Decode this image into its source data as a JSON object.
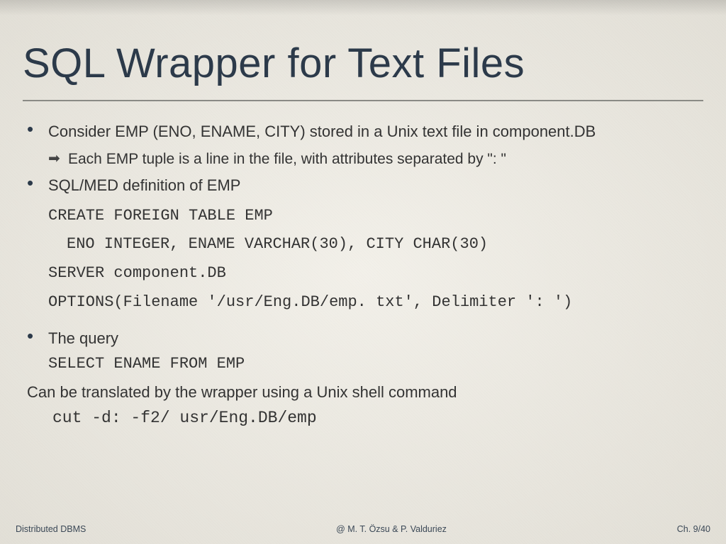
{
  "title": "SQL Wrapper for Text Files",
  "bullets": {
    "b1": "Consider EMP (ENO, ENAME, CITY) stored in a Unix text file in component.DB",
    "b1_sub": "Each EMP tuple is a line in the file, with attributes separated by \": \"",
    "b2": "SQL/MED definition of EMP",
    "b3": "The query"
  },
  "code": {
    "l1": "CREATE FOREIGN TABLE EMP",
    "l2": "ENO INTEGER, ENAME VARCHAR(30), CITY CHAR(30)",
    "l3": "SERVER component.DB",
    "l4": "OPTIONS(Filename '/usr/Eng.DB/emp. txt', Delimiter ': ')",
    "query": "SELECT ENAME FROM EMP"
  },
  "tail": {
    "text": "Can be translated by the wrapper using a Unix shell command",
    "cmd": "cut -d: -f2/ usr/Eng.DB/emp"
  },
  "footer": {
    "left": "Distributed DBMS",
    "center": "@ M. T. Özsu & P. Valduriez",
    "right": "Ch. 9/40"
  }
}
